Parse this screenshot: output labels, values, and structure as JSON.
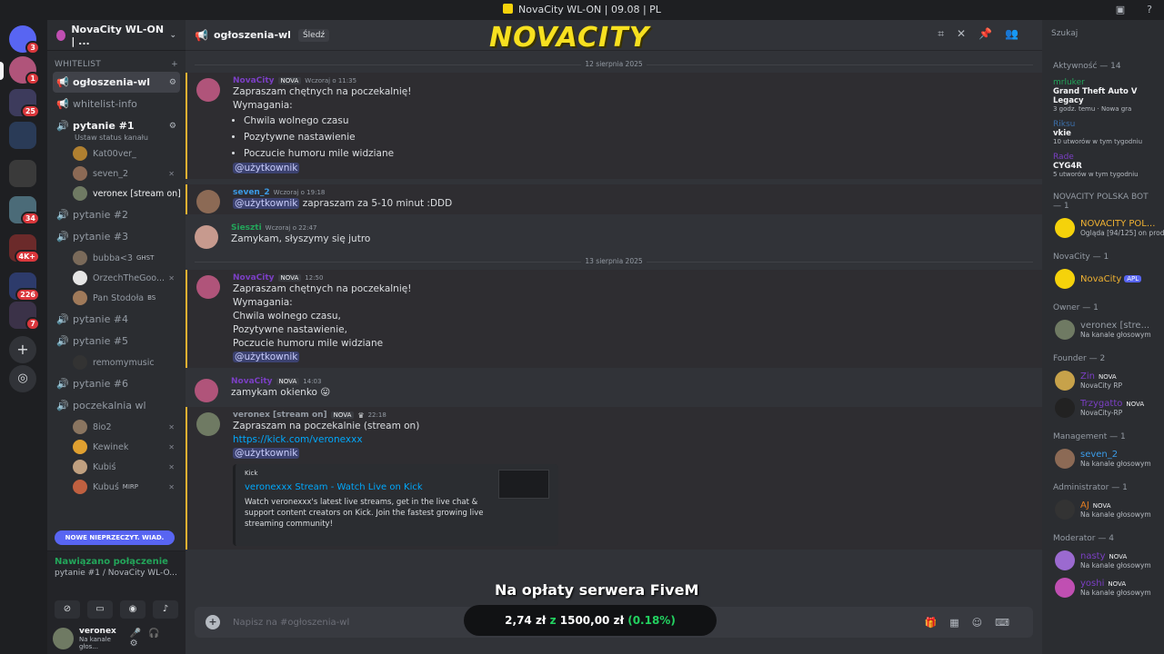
{
  "title_bar": {
    "text": "NovaCity WL-ON | 09.08 | PL"
  },
  "server_rail": {
    "badges": [
      "3",
      "1",
      "25",
      "34",
      "4K+",
      "226",
      "7"
    ]
  },
  "guild": {
    "name": "NovaCity WL-ON | ..."
  },
  "sidebar": {
    "category": "WHITELIST",
    "channels": [
      {
        "name": "ogłoszenia-wl",
        "active": true
      },
      {
        "name": "whitelist-info"
      },
      {
        "name": "pytanie #1",
        "sub": "Ustaw status kanału"
      }
    ],
    "voice1_users": [
      {
        "name": "Kat00ver_"
      },
      {
        "name": "seven_2"
      },
      {
        "name": "veronex [stream on]"
      }
    ],
    "voice_channels": [
      {
        "name": "pytanie #2"
      },
      {
        "name": "pytanie #3"
      }
    ],
    "voice3_users": [
      {
        "name": "bubba<3",
        "tag": "GHST"
      },
      {
        "name": "OrzechTheGoo..."
      },
      {
        "name": "Pan Stodoła",
        "tag": "BS"
      }
    ],
    "voice_channels_2": [
      {
        "name": "pytanie #4"
      },
      {
        "name": "pytanie #5"
      }
    ],
    "voice5_users": [
      {
        "name": "remomymusic"
      }
    ],
    "voice_channels_3": [
      {
        "name": "pytanie #6"
      },
      {
        "name": "poczekalnia wl"
      }
    ],
    "waiting_users": [
      {
        "name": "8io2"
      },
      {
        "name": "Kewinek"
      },
      {
        "name": "Kubiś"
      },
      {
        "name": "Kubuś",
        "tag": "MIRP"
      }
    ],
    "new_unread": "NOWE NIEPRZECZYT. WIAD.",
    "voice_status": "Nawiązano połączenie",
    "voice_channel": "pytanie #1 / NovaCity WL-O...",
    "user": {
      "name": "veronex",
      "status": "Na kanale głos..."
    }
  },
  "chat": {
    "channel": "ogłoszenia-wl",
    "follow": "Śledź",
    "logo": "NOVACITY",
    "dates": [
      "12 sierpnia 2025",
      "13 sierpnia 2025"
    ],
    "messages": [
      {
        "author": "NovaCity",
        "tag": "NOVA",
        "time": "Wczoraj o 11:35",
        "line1": "Zapraszam chętnych na poczekalnię!",
        "line2": "Wymagania:",
        "bullets": [
          "Chwila wolnego czasu",
          "Pozytywne nastawienie",
          "Poczucie humoru mile widziane"
        ],
        "mention": "@użytkownik"
      },
      {
        "author": "seven_2",
        "time": "Wczoraj o 19:18",
        "mention": "@użytkownik",
        "text": "zapraszam za 5-10 minut :DDD"
      },
      {
        "author": "Sieszti",
        "time": "Wczoraj o 22:47",
        "text": "Zamykam, słyszymy się jutro"
      },
      {
        "author": "NovaCity",
        "tag": "NOVA",
        "time": "12:50",
        "lines": [
          "Zapraszam chętnych na poczekalnię!",
          "Wymagania:",
          "Chwila wolnego czasu,",
          "Pozytywne nastawienie,",
          "Poczucie humoru mile widziane"
        ],
        "mention": "@użytkownik"
      },
      {
        "author": "NovaCity",
        "tag": "NOVA",
        "time": "14:03",
        "text": "zamykam okienko"
      },
      {
        "author": "veronex [stream on]",
        "tag": "NOVA",
        "time": "22:18",
        "text": "Zapraszam na poczekalnie (stream on)",
        "link": "https://kick.com/veronexxx",
        "mention": "@użytkownik",
        "embed": {
          "provider": "Kick",
          "title": "veronexxx Stream - Watch Live on Kick",
          "desc": "Watch veronexxx's latest live streams, get in the live chat & support content creators on Kick. Join the fastest growing live streaming community!"
        }
      }
    ],
    "composer_placeholder": "Napisz na #ogłoszenia-wl",
    "overlay_title": "Na opłaty serwera FiveM",
    "donate_current": "2,74 zł",
    "donate_sep": "z",
    "donate_goal": "1500,00 zł",
    "donate_pct": "(0.18%)"
  },
  "members": {
    "search_placeholder": "Szukaj",
    "activity_header": "Aktywność — 14",
    "activities": [
      {
        "name": "mrluker",
        "title": "Grand Theft Auto V Legacy",
        "sub": "3 godz. temu · Nowa gra"
      },
      {
        "name": "Riksu",
        "title": "vkie",
        "sub": "10 utworów w tym tygodniu"
      },
      {
        "name": "Rade",
        "title": "CYG4R",
        "sub": "5 utworów w tym tygodniu"
      }
    ],
    "bot_group": "NOVACITY POLSKA BOT — 1",
    "bot": {
      "name": "NOVACITY POL...",
      "status": "Ogląda [94/125] on prod"
    },
    "nova_group": "NovaCity — 1",
    "nova": {
      "name": "NovaCity",
      "badge": "APL"
    },
    "owner_group": "Owner — 1",
    "owner": {
      "name": "veronex [stre...",
      "status": "Na kanale głosowym"
    },
    "founder_group": "Founder — 2",
    "founders": [
      {
        "name": "Zin",
        "tag": "NOVA",
        "status": "NovaCity RP"
      },
      {
        "name": "Trzygatto",
        "tag": "NOVA",
        "status": "NovaCity-RP"
      }
    ],
    "mgmt_group": "Management — 1",
    "mgmt": {
      "name": "seven_2",
      "status": "Na kanale głosowym"
    },
    "admin_group": "Administrator — 1",
    "admin": {
      "name": "AJ",
      "tag": "NOVA",
      "status": "Na kanale głosowym"
    },
    "mod_group": "Moderator — 4",
    "mods": [
      {
        "name": "nasty",
        "tag": "NOVA",
        "status": "Na kanale głosowym"
      },
      {
        "name": "yoshi",
        "tag": "NOVA",
        "status": "Na kanale głosowym"
      }
    ]
  }
}
